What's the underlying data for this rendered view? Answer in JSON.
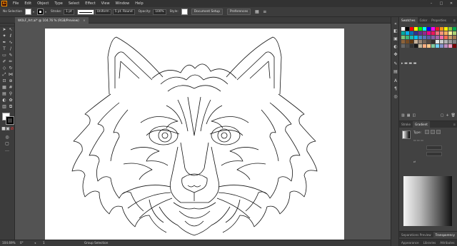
{
  "app": {
    "logo": "Ai",
    "accent": "#ff9a00"
  },
  "menu": {
    "items": [
      "File",
      "Edit",
      "Object",
      "Type",
      "Select",
      "Effect",
      "View",
      "Window",
      "Help"
    ],
    "minimize": "–",
    "maximize": "□",
    "close": "✕"
  },
  "control": {
    "selection": "No Selection",
    "stroke_label": "Stroke:",
    "stroke_weight": "1 pt",
    "profile": "Uniform",
    "brush": "5 pt. Round",
    "opacity_label": "Opacity:",
    "opacity": "100%",
    "style_label": "Style:",
    "doc_setup": "Document Setup",
    "preferences": "Preferences"
  },
  "document": {
    "tab_title": "WOLF_Art.ai* @ 104.76 % (RGB/Preview)",
    "close": "×"
  },
  "status": {
    "zoom": "104.69%",
    "rotation": "0°",
    "page": "1",
    "tool": "Group Selection"
  },
  "panels": {
    "top_tabs": [
      "Swatches",
      "Color",
      "Properties"
    ],
    "mid_tabs": [
      "Stroke",
      "Gradient"
    ],
    "gradient": {
      "type_label": "Type:"
    },
    "trans_tabs": [
      "Separations Preview",
      "Transparency"
    ],
    "bottom_tabs": [
      "Appearance",
      "Libraries",
      "Attributes"
    ],
    "menu_icon": "≡"
  },
  "swatches": {
    "colors": [
      "#ffffff",
      "#000000",
      "#ff0000",
      "#ffff00",
      "#00ff00",
      "#00ffff",
      "#0000ff",
      "#ff00ff",
      "#ed1c24",
      "#f7941d",
      "#fff200",
      "#8dc63f",
      "#00a651",
      "#00a99d",
      "#00aeef",
      "#0072bc",
      "#2e3192",
      "#662d91",
      "#92278f",
      "#ec008c",
      "#ed145b",
      "#f26d7d",
      "#f69679",
      "#fbaf5d",
      "#fff799",
      "#acd373",
      "#7cc576",
      "#3bb878",
      "#1abbb4",
      "#00bff3",
      "#448ccb",
      "#5674b9",
      "#605ca8",
      "#8560a8",
      "#a864a8",
      "#f06eaa",
      "#f26c4f",
      "#c69c6d",
      "#a67c52",
      "#8c6239",
      "#754c24",
      "#603913",
      "#c7b299",
      "#998675",
      "#736357",
      "#534741",
      "#362f2d",
      "#e6e6e6",
      "#cccccc",
      "#b3b3b3",
      "#999999",
      "#808080",
      "#666666",
      "#4d4d4d",
      "#333333",
      "#1a1a1a",
      "#c2b59b",
      "#f9ad81",
      "#fdc689",
      "#82ca9c",
      "#6dcff6",
      "#8493ca",
      "#bd8cbf",
      "#f49ac1",
      "#790000"
    ]
  }
}
